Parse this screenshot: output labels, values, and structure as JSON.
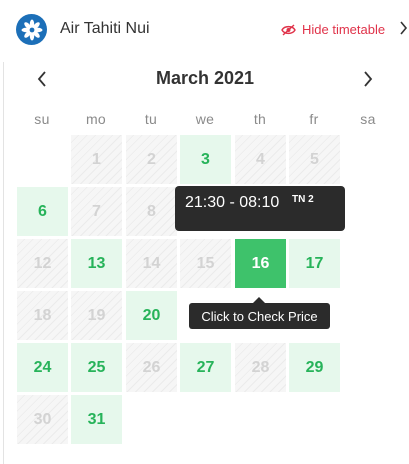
{
  "header": {
    "airline_name": "Air Tahiti Nui",
    "hide_timetable_label": "Hide timetable",
    "logo_icon": "snowflake-flower-icon",
    "brand_color": "#1c6fb8",
    "accent_color": "#e0334a"
  },
  "calendar": {
    "month_title": "March 2021",
    "weekdays": [
      "su",
      "mo",
      "tu",
      "we",
      "th",
      "fr",
      "sa"
    ],
    "available_color": "#e6f8ec",
    "selected_color": "#3ec26b",
    "days": [
      {
        "label": "1",
        "state": "disabled"
      },
      {
        "label": "2",
        "state": "disabled"
      },
      {
        "label": "3",
        "state": "available"
      },
      {
        "label": "4",
        "state": "disabled"
      },
      {
        "label": "5",
        "state": "disabled"
      },
      {
        "label": "6",
        "state": "available"
      },
      {
        "label": "7",
        "state": "disabled"
      },
      {
        "label": "8",
        "state": "disabled"
      },
      {
        "label": "12",
        "state": "disabled"
      },
      {
        "label": "13",
        "state": "available"
      },
      {
        "label": "14",
        "state": "disabled"
      },
      {
        "label": "15",
        "state": "disabled"
      },
      {
        "label": "16",
        "state": "selected"
      },
      {
        "label": "17",
        "state": "available"
      },
      {
        "label": "18",
        "state": "disabled"
      },
      {
        "label": "19",
        "state": "disabled"
      },
      {
        "label": "20",
        "state": "available"
      },
      {
        "label": "24",
        "state": "available"
      },
      {
        "label": "25",
        "state": "available"
      },
      {
        "label": "26",
        "state": "disabled"
      },
      {
        "label": "27",
        "state": "available"
      },
      {
        "label": "28",
        "state": "disabled"
      },
      {
        "label": "29",
        "state": "available"
      },
      {
        "label": "30",
        "state": "disabled"
      },
      {
        "label": "31",
        "state": "available"
      }
    ]
  },
  "timetable_tooltip": {
    "time": "21:30 - 08:10",
    "flight": "TN 2"
  },
  "price_tooltip": {
    "label": "Click to Check Price"
  }
}
